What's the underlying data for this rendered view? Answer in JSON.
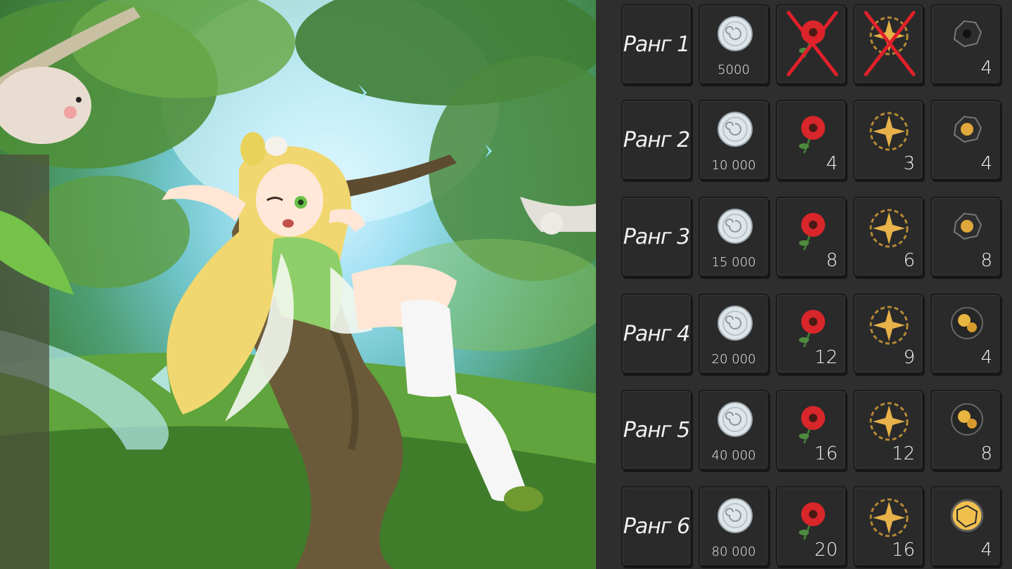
{
  "rows": [
    {
      "rank": "Ранг 1",
      "silver": "5000",
      "flower": "",
      "flower_crossed": true,
      "star": "",
      "star_crossed": true,
      "orb": "4",
      "orb_icon": "dark-ore-icon"
    },
    {
      "rank": "Ранг 2",
      "silver": "10 000",
      "flower": "4",
      "flower_crossed": false,
      "star": "3",
      "star_crossed": false,
      "orb": "4",
      "orb_icon": "dark-gold-ore-icon"
    },
    {
      "rank": "Ранг 3",
      "silver": "15 000",
      "flower": "8",
      "flower_crossed": false,
      "star": "6",
      "star_crossed": false,
      "orb": "8",
      "orb_icon": "dark-gold-ore-icon"
    },
    {
      "rank": "Ранг 4",
      "silver": "20 000",
      "flower": "12",
      "flower_crossed": false,
      "star": "9",
      "star_crossed": false,
      "orb": "4",
      "orb_icon": "gold-ore-icon"
    },
    {
      "rank": "Ранг 5",
      "silver": "40 000",
      "flower": "16",
      "flower_crossed": false,
      "star": "12",
      "star_crossed": false,
      "orb": "8",
      "orb_icon": "gold-ore-icon"
    },
    {
      "rank": "Ранг 6",
      "silver": "80 000",
      "flower": "20",
      "flower_crossed": false,
      "star": "16",
      "star_crossed": false,
      "orb": "4",
      "orb_icon": "bright-gold-orb-icon"
    }
  ],
  "colors": {
    "cross": "#e0202a",
    "flower": "#d8262a",
    "silver": "#dfe6ea",
    "gold": "#e7b24a"
  }
}
